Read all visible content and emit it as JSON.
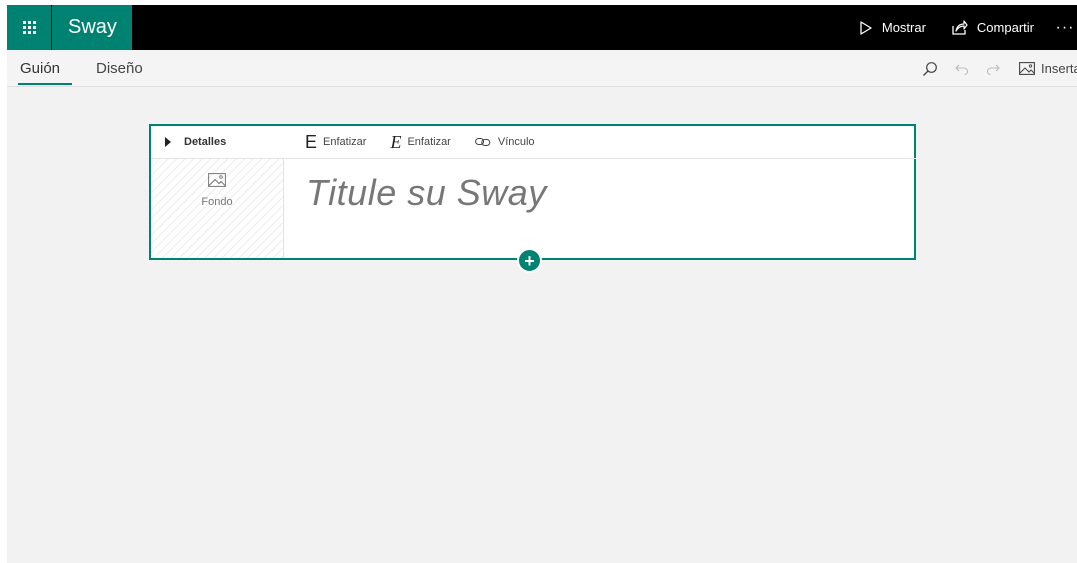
{
  "header": {
    "app_name": "Sway",
    "show_label": "Mostrar",
    "share_label": "Compartir",
    "more_label": "···"
  },
  "tabs": [
    {
      "label": "Guión",
      "active": true
    },
    {
      "label": "Diseño",
      "active": false
    }
  ],
  "toolbar": {
    "insert_label": "Insertar"
  },
  "title_card": {
    "details_label": "Detalles",
    "background_label": "Fondo",
    "format_buttons": [
      {
        "glyph": "E",
        "label": "Enfatizar"
      },
      {
        "glyph": "E",
        "label": "Enfatizar"
      },
      {
        "label": "Vínculo"
      }
    ],
    "title_placeholder": "Titule su Sway"
  },
  "colors": {
    "accent": "#008272",
    "topbar": "#000000",
    "canvas": "#f2f2f2"
  }
}
